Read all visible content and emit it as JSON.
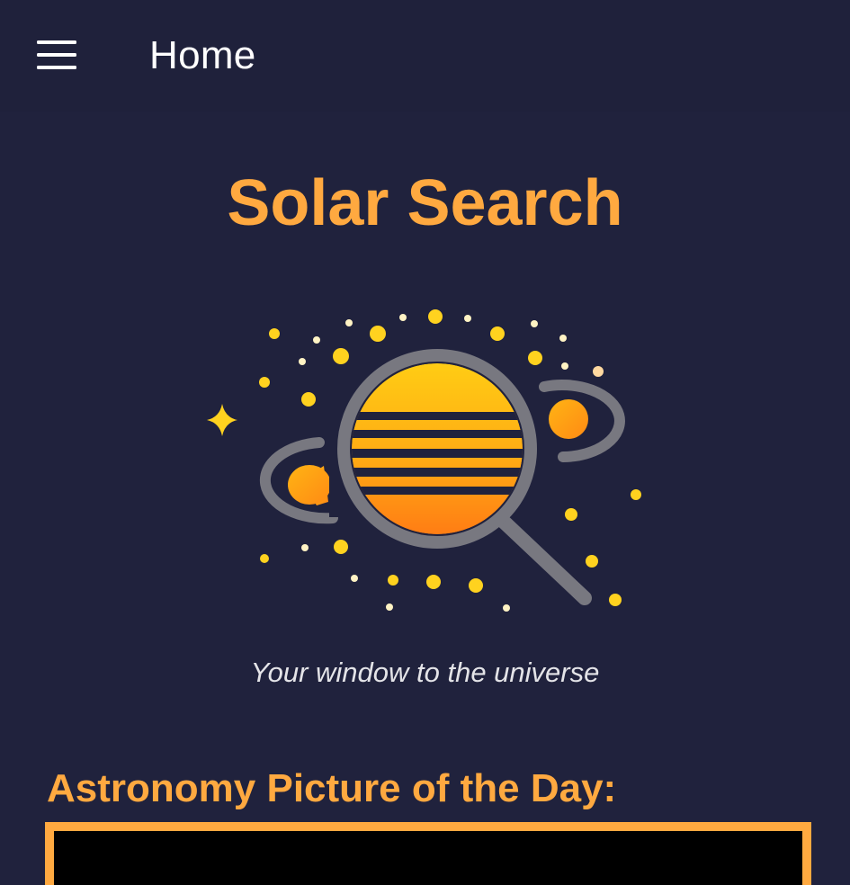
{
  "app_bar": {
    "title": "Home",
    "menu_icon": "hamburger-menu-icon"
  },
  "hero": {
    "title": "Solar Search",
    "logo_icon": "planet-magnifier-logo-icon",
    "tagline": "Your window to the universe"
  },
  "apod": {
    "heading": "Astronomy Picture of the Day:"
  },
  "colors": {
    "background": "#20223d",
    "app_bar": "#1f213b",
    "accent": "#ffa940",
    "title_text": "#ffffff",
    "tagline_text": "#e4e4e8",
    "star_yellow": "#ffd21f"
  }
}
